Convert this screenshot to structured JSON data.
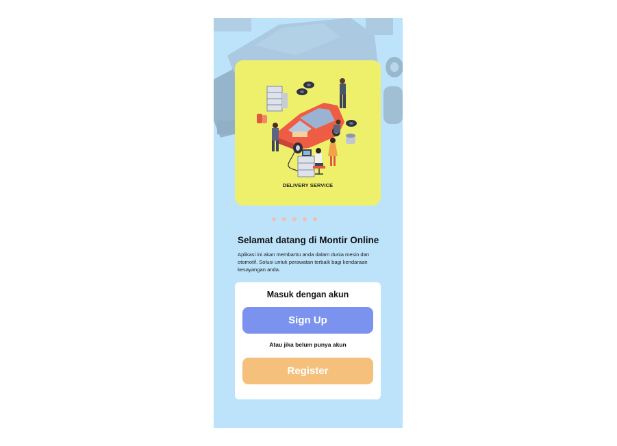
{
  "hero": {
    "caption": "DELIVERY SERVICE",
    "illustration": "car-repair-workshop-illustration"
  },
  "carousel": {
    "dot_count": 5,
    "dot_color": "#f3bfb5"
  },
  "welcome": {
    "title": "Selamat datang di Montir Online",
    "description": "Aplikasi ini akan membantu anda dalam dunia mesin dan otomotif. Solusi untuk perawatan terbaik bagi kendaraan kesayangan anda."
  },
  "login": {
    "title": "Masuk dengan akun",
    "signup_label": "Sign Up",
    "alt_text": "Atau jika belum punya akun",
    "register_label": "Register"
  },
  "colors": {
    "screen_bg": "#bde3fb",
    "hero_bg": "#eef06b",
    "signup": "#7b93ee",
    "register": "#f4c07c"
  }
}
